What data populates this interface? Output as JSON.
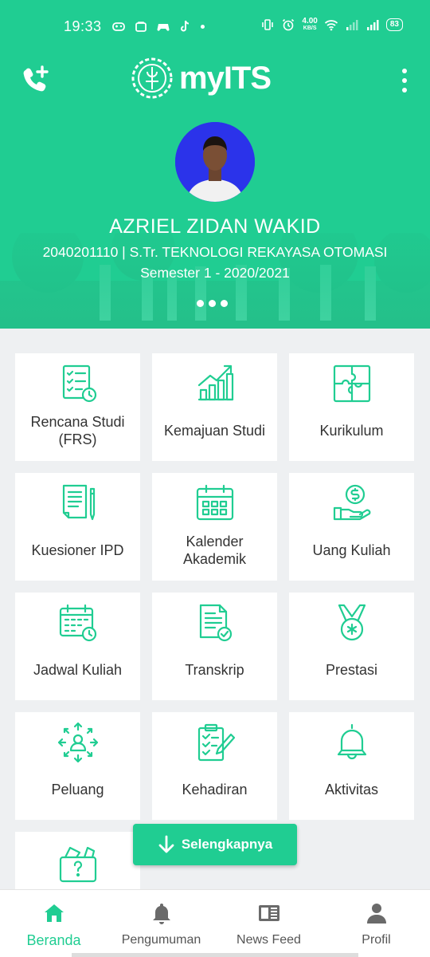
{
  "status_bar": {
    "time": "19:33",
    "speed_value": "4.00",
    "speed_unit": "KB/S",
    "battery": "83"
  },
  "header": {
    "app_name": "myITS",
    "user_name": "AZRIEL ZIDAN WAKID",
    "user_id_program": "2040201110 | S.Tr. TEKNOLOGI REKAYASA OTOMASI",
    "semester": "Semester 1 - 2020/2021"
  },
  "menu": [
    {
      "label": "Rencana Studi (FRS)",
      "icon": "checklist-clock-icon"
    },
    {
      "label": "Kemajuan Studi",
      "icon": "growth-chart-icon"
    },
    {
      "label": "Kurikulum",
      "icon": "puzzle-icon"
    },
    {
      "label": "Kuesioner IPD",
      "icon": "document-pen-icon"
    },
    {
      "label": "Kalender Akademik",
      "icon": "calendar-icon"
    },
    {
      "label": "Uang Kuliah",
      "icon": "money-hand-icon"
    },
    {
      "label": "Jadwal Kuliah",
      "icon": "calendar-clock-icon"
    },
    {
      "label": "Transkrip",
      "icon": "document-check-icon"
    },
    {
      "label": "Prestasi",
      "icon": "medal-icon"
    },
    {
      "label": "Peluang",
      "icon": "person-arrows-icon"
    },
    {
      "label": "Kehadiran",
      "icon": "clipboard-pen-icon"
    },
    {
      "label": "Aktivitas",
      "icon": "bell-icon"
    },
    {
      "label": "",
      "icon": "question-box-icon"
    }
  ],
  "more_button": "Selengkapnya",
  "bottom_nav": [
    {
      "label": "Beranda",
      "icon": "home-icon",
      "active": true
    },
    {
      "label": "Pengumuman",
      "icon": "bell-icon",
      "active": false
    },
    {
      "label": "News Feed",
      "icon": "newspaper-icon",
      "active": false
    },
    {
      "label": "Profil",
      "icon": "person-icon",
      "active": false
    }
  ],
  "colors": {
    "primary": "#20cd92",
    "background": "#eef0f2",
    "avatar_bg": "#2b33ea"
  }
}
